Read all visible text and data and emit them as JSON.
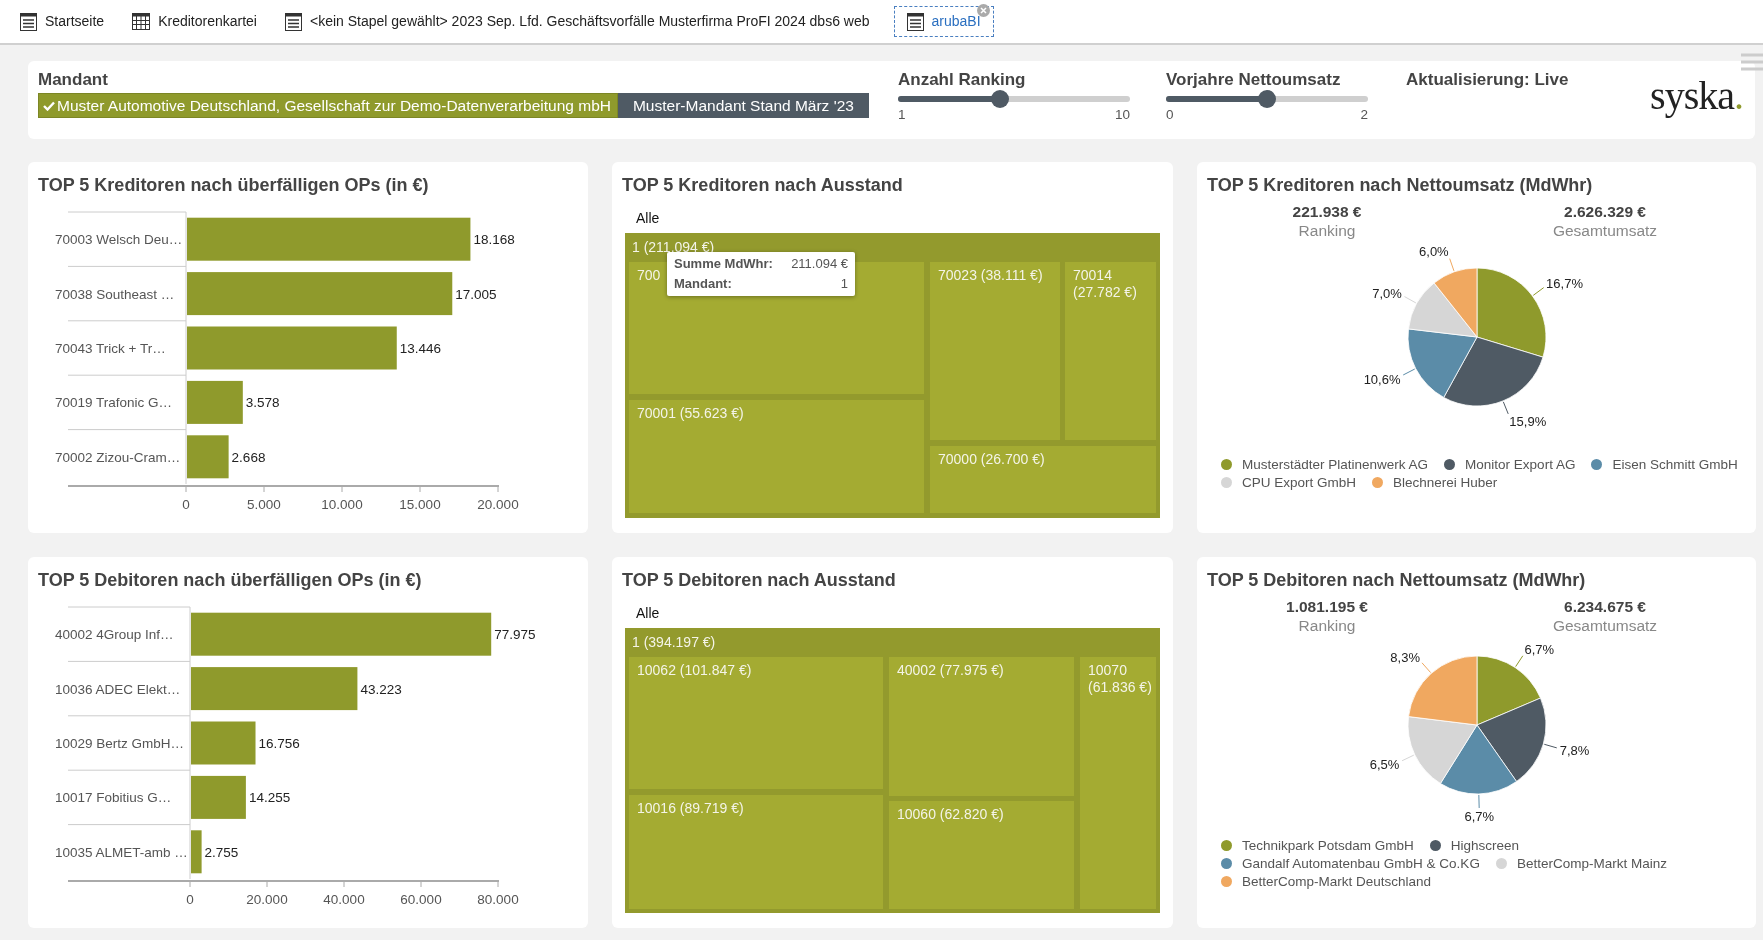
{
  "tabs": [
    {
      "label": "Startseite",
      "kind": "list",
      "selected": false,
      "closable": false
    },
    {
      "label": "Kreditorenkartei",
      "kind": "grid",
      "selected": false,
      "closable": false
    },
    {
      "label": "<kein Stapel gewählt> 2023 Sep. Lfd. Geschäftsvorfälle Musterfirma ProFI 2024 dbs6 web",
      "kind": "list",
      "selected": false,
      "closable": false
    },
    {
      "label": "arubaBI",
      "kind": "list",
      "selected": true,
      "closable": true
    }
  ],
  "filter_bar": {
    "mandant": {
      "label": "Mandant",
      "options": [
        {
          "label": "Muster Automotive Deutschland, Gesellschaft zur Demo-Datenverarbeitung mbH",
          "selected": true
        },
        {
          "label": "Muster-Mandant Stand März '23",
          "selected": false
        }
      ]
    },
    "sliders": [
      {
        "label": "Anzahl Ranking",
        "level": 0.44,
        "min": "1",
        "max": "10"
      },
      {
        "label": "Vorjahre Nettoumsatz",
        "level": 0.5,
        "min": "0",
        "max": "2"
      }
    ],
    "update_status": "Aktualisierung: Live",
    "logo": "syska."
  },
  "panels": [
    {
      "kind": "bar",
      "title": "TOP 5 Kreditoren nach überfälligen OPs (in €)",
      "chart_data": {
        "type": "bar",
        "orientation": "horizontal",
        "categories": [
          "70003 Welsch Deu…",
          "70038 Southeast …",
          "70043 Trick + Tr…",
          "70019 Trafonic G…",
          "70002 Zizou-Cram…"
        ],
        "values": [
          18168,
          17005,
          13446,
          3578,
          2668
        ],
        "value_labels": [
          "18.168",
          "17.005",
          "13.446",
          "3.578",
          "2.668"
        ],
        "xlim": [
          0,
          20000
        ],
        "xticks": [
          {
            "value": 0,
            "label": "0"
          },
          {
            "value": 5000,
            "label": "5.000"
          },
          {
            "value": 10000,
            "label": "10.000"
          },
          {
            "value": 15000,
            "label": "15.000"
          },
          {
            "value": 20000,
            "label": "20.000"
          }
        ]
      }
    },
    {
      "kind": "treemap",
      "title": "TOP 5 Kreditoren nach Ausstand",
      "filter": "Alle",
      "root": "1 (211.094 €)",
      "cells": [
        "700",
        "70001 (55.623 €)",
        "70023 (38.111 €)",
        "70014 (27.782 €)",
        "70000 (26.700 €)"
      ],
      "tooltip": [
        {
          "label": "Summe MdWhr:",
          "value": "211.094 €"
        },
        {
          "label": "Mandant:",
          "value": "1"
        }
      ]
    },
    {
      "kind": "pie",
      "title": "TOP 5 Kreditoren nach Nettoumsatz (MdWhr)",
      "kpis": [
        {
          "value": "221.938 €",
          "label": "Ranking"
        },
        {
          "value": "2.626.329 €",
          "label": "Gesamtumsatz"
        }
      ],
      "chart_data": {
        "type": "pie",
        "categories": [
          "Musterstädter Platinenwerk AG",
          "Monitor Export AG",
          "Eisen Schmitt GmbH",
          "CPU Export GmbH",
          "Blechnerei Huber"
        ],
        "values": [
          16.7,
          15.9,
          10.6,
          7.0,
          6.0
        ],
        "colors": [
          "#8f9a2c",
          "#4f5a64",
          "#5b8ca8",
          "#d6d6d6",
          "#f0a860"
        ],
        "value_labels": [
          "16,7%",
          "15,9%",
          "10,6%",
          "7,0%",
          "6,0%"
        ]
      }
    },
    {
      "kind": "bar",
      "title": "TOP 5 Debitoren nach überfälligen OPs (in €)",
      "chart_data": {
        "type": "bar",
        "orientation": "horizontal",
        "categories": [
          "40002 4Group Inf…",
          "10036 ADEC Elekt…",
          "10029 Bertz GmbH…",
          "10017 Fobitius G…",
          "10035 ALMET-amb …"
        ],
        "values": [
          77975,
          43223,
          16756,
          14255,
          2755
        ],
        "value_labels": [
          "77.975",
          "43.223",
          "16.756",
          "14.255",
          "2.755"
        ],
        "xlim": [
          0,
          80000
        ],
        "xticks": [
          {
            "value": 0,
            "label": "0"
          },
          {
            "value": 20000,
            "label": "20.000"
          },
          {
            "value": 40000,
            "label": "40.000"
          },
          {
            "value": 60000,
            "label": "60.000"
          },
          {
            "value": 80000,
            "label": "80.000"
          }
        ]
      }
    },
    {
      "kind": "treemap",
      "title": "TOP 5 Debitoren nach Ausstand",
      "filter": "Alle",
      "root": "1 (394.197 €)",
      "cells": [
        "10062 (101.847 €)",
        "10016 (89.719 €)",
        "40002 (77.975 €)",
        "10060 (62.820 €)",
        "10070 (61.836 €)"
      ]
    },
    {
      "kind": "pie",
      "title": "TOP 5 Debitoren nach Nettoumsatz (MdWhr)",
      "kpis": [
        {
          "value": "1.081.195 €",
          "label": "Ranking"
        },
        {
          "value": "6.234.675 €",
          "label": "Gesamtumsatz"
        }
      ],
      "chart_data": {
        "type": "pie",
        "categories": [
          "Technikpark Potsdam GmbH",
          "Highscreen",
          "Gandalf Automatenbau GmbH & Co.KG",
          "BetterComp-Markt Mainz",
          "BetterComp-Markt Deutschland"
        ],
        "values": [
          6.7,
          7.8,
          6.7,
          6.5,
          8.3
        ],
        "colors": [
          "#8f9a2c",
          "#4f5a64",
          "#5b8ca8",
          "#d6d6d6",
          "#f0a860"
        ],
        "value_labels": [
          "6,7%",
          "7,8%",
          "6,7%",
          "6,5%",
          "8,3%"
        ]
      }
    }
  ]
}
